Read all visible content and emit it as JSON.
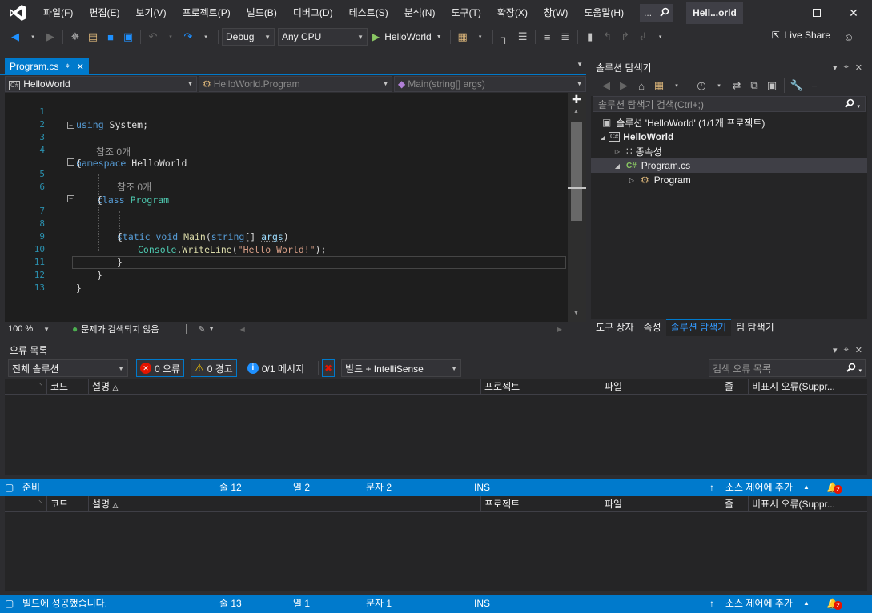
{
  "menu": {
    "items": [
      "파일(F)",
      "편집(E)",
      "보기(V)",
      "프로젝트(P)",
      "빌드(B)",
      "디버그(D)",
      "테스트(S)",
      "분석(N)",
      "도구(T)",
      "확장(X)",
      "창(W)",
      "도움말(H)"
    ],
    "search_label": "...",
    "solution_title": "Hell...orld"
  },
  "toolbar": {
    "config": "Debug",
    "platform": "Any CPU",
    "run_label": "HelloWorld",
    "live_share": "Live Share"
  },
  "editor": {
    "tab_name": "Program.cs",
    "nav_project": "HelloWorld",
    "nav_class": "HelloWorld.Program",
    "nav_member": "Main(string[] args)",
    "zoom": "100 %",
    "issues": "문제가 검색되지 않음",
    "lines": {
      "l1": {
        "num": "1",
        "kw": "using",
        "rest": " System;"
      },
      "l2": {
        "num": "2"
      },
      "l3": {
        "num": "3",
        "kw": "namespace",
        "rest": " HelloWorld"
      },
      "l4": {
        "num": "4",
        "rest": "{"
      },
      "ref1": "참조 0개",
      "l5": {
        "num": "5",
        "kw": "class",
        "ty": "Program"
      },
      "l6": {
        "num": "6",
        "rest": "{"
      },
      "ref2": "참조 0개",
      "l7": {
        "num": "7",
        "kw1": "static",
        "kw2": "void",
        "fn": "Main",
        "p1": "(",
        "kw3": "string",
        "p2": "[] ",
        "arg": "args",
        "p3": ")"
      },
      "l8": {
        "num": "8",
        "rest": "{"
      },
      "l9": {
        "num": "9",
        "ty": "Console",
        "p1": ".",
        "fn": "WriteLine",
        "p2": "(",
        "str": "\"Hello World!\"",
        "p3": ");"
      },
      "l10": {
        "num": "10",
        "rest": "}"
      },
      "l11": {
        "num": "11",
        "rest": "}"
      },
      "l12": {
        "num": "12",
        "rest": "}"
      },
      "l13": {
        "num": "13"
      }
    }
  },
  "solution_explorer": {
    "title": "솔루션 탐색기",
    "search_placeholder": "솔루션 탐색기 검색(Ctrl+;)",
    "tree": {
      "solution": "솔루션 'HelloWorld' (1/1개 프로젝트)",
      "project": "HelloWorld",
      "dependencies": "종속성",
      "file": "Program.cs",
      "class": "Program"
    },
    "tabs": [
      "도구 상자",
      "속성",
      "솔루션 탐색기",
      "팀 탐색기"
    ]
  },
  "error_list": {
    "title": "오류 목록",
    "scope": "전체 솔루션",
    "errors": "0 오류",
    "warnings": "0 경고",
    "messages": "0/1 메시지",
    "build_filter": "빌드 + IntelliSense",
    "search_placeholder": "검색 오류 목록",
    "columns": [
      "코드",
      "설명",
      "프로젝트",
      "파일",
      "줄",
      "비표시 오류(Suppr..."
    ]
  },
  "status_top": {
    "state": "준비",
    "line": "줄 12",
    "col": "열 2",
    "char": "문자 2",
    "mode": "INS",
    "source_control": "소스 제어에 추가",
    "notif_count": "2"
  },
  "status_bottom": {
    "state": "빌드에 성공했습니다.",
    "line": "줄 13",
    "col": "열 1",
    "char": "문자 1",
    "mode": "INS",
    "source_control": "소스 제어에 추가",
    "notif_count": "2"
  },
  "colors": {
    "accent": "#007acc",
    "background": "#2d2d30",
    "editor_bg": "#1e1e1e"
  }
}
